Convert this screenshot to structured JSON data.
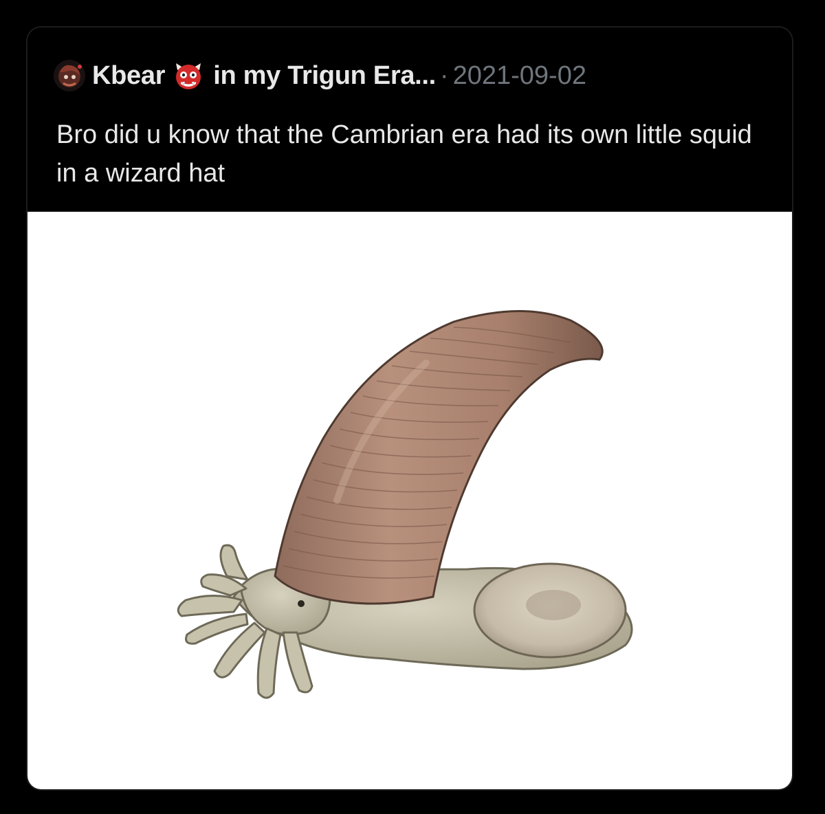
{
  "tweet": {
    "author_display_name": "Kbear",
    "author_suffix": "in my Trigun Era...",
    "separator": "·",
    "date": "2021-09-02",
    "text": "Bro did u know that the Cambrian era had its own little squid in a wizard hat",
    "avatar_icon": "avatar-icon",
    "name_emoji_icon": "ogre-emoji-icon"
  },
  "media": {
    "icon": "cambrian-squid-illustration"
  },
  "colors": {
    "background": "#000000",
    "text": "#e8e8e8",
    "muted": "#6f767c",
    "media_background": "#ffffff",
    "shell": "#a57e6c",
    "body": "#cbc6b2"
  }
}
